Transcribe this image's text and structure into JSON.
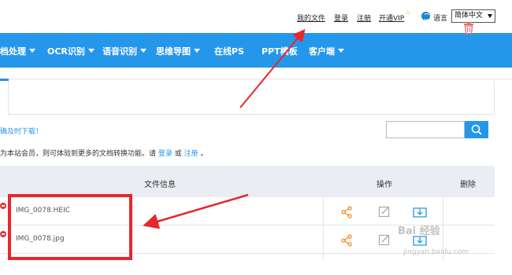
{
  "topbar": {
    "my_files": "我的文件",
    "login": "登录",
    "register": "注册",
    "vip": "开通VIP",
    "language_label": "语言",
    "language_value": "简体中文"
  },
  "nav": {
    "items": [
      {
        "label": "档处理",
        "dropdown": true
      },
      {
        "label": "OCR识别",
        "dropdown": true
      },
      {
        "label": "语音识别",
        "dropdown": true
      },
      {
        "label": "思维导图",
        "dropdown": true
      },
      {
        "label": "在线PS",
        "dropdown": false
      },
      {
        "label": "PPT模板",
        "dropdown": false
      },
      {
        "label": "客户端",
        "dropdown": true
      }
    ],
    "bg_color": "#2597ea"
  },
  "notice": {
    "text": "确及时下载！"
  },
  "search": {
    "placeholder": "",
    "icon": "search-icon"
  },
  "member": {
    "text_prefix": "为本站会员，则可体验到更多的文档转换功能。请",
    "login": "登录",
    "or": "或",
    "register": "注册",
    "suffix": "。"
  },
  "table": {
    "headers": {
      "info": "文件信息",
      "ops": "操作",
      "delete": "删除"
    },
    "rows": [
      {
        "filename": "IMG_0078.HEIC"
      },
      {
        "filename": "IMG_0078.jpg"
      }
    ]
  },
  "watermark": {
    "brand": "Bai 经验",
    "sub": "jingyan.baidu.com"
  },
  "colors": {
    "accent": "#2597ea",
    "highlight": "#e8262c",
    "share": "#f08a24",
    "trash": "#e86a6a"
  }
}
